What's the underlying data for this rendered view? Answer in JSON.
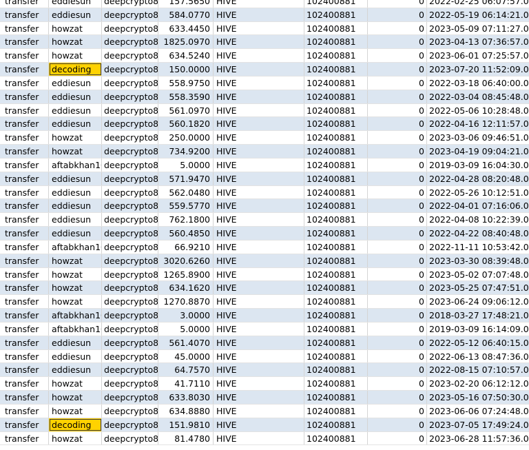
{
  "table": {
    "rows": [
      {
        "type": "transfer",
        "from": "eddiesun",
        "to": "deepcrypto8",
        "amount": "157.5650",
        "asset": "HIVE",
        "block": "102400881",
        "flag": "0",
        "date": "2022-02-25 06:07:57.000",
        "highlight": false
      },
      {
        "type": "transfer",
        "from": "eddiesun",
        "to": "deepcrypto8",
        "amount": "584.0770",
        "asset": "HIVE",
        "block": "102400881",
        "flag": "0",
        "date": "2022-05-19 06:14:21.000",
        "highlight": false
      },
      {
        "type": "transfer",
        "from": "howzat",
        "to": "deepcrypto8",
        "amount": "633.4450",
        "asset": "HIVE",
        "block": "102400881",
        "flag": "0",
        "date": "2023-05-09 07:11:27.000",
        "highlight": false
      },
      {
        "type": "transfer",
        "from": "howzat",
        "to": "deepcrypto8",
        "amount": "1825.0970",
        "asset": "HIVE",
        "block": "102400881",
        "flag": "0",
        "date": "2023-04-13 07:36:57.000",
        "highlight": false
      },
      {
        "type": "transfer",
        "from": "howzat",
        "to": "deepcrypto8",
        "amount": "634.5240",
        "asset": "HIVE",
        "block": "102400881",
        "flag": "0",
        "date": "2023-06-01 07:25:57.000",
        "highlight": false
      },
      {
        "type": "transfer",
        "from": "decoding",
        "to": "deepcrypto8",
        "amount": "150.0000",
        "asset": "HIVE",
        "block": "102400881",
        "flag": "0",
        "date": "2023-07-20 11:52:09.000",
        "highlight": true
      },
      {
        "type": "transfer",
        "from": "eddiesun",
        "to": "deepcrypto8",
        "amount": "558.9750",
        "asset": "HIVE",
        "block": "102400881",
        "flag": "0",
        "date": "2022-03-18 06:40:00.000",
        "highlight": false
      },
      {
        "type": "transfer",
        "from": "eddiesun",
        "to": "deepcrypto8",
        "amount": "558.3590",
        "asset": "HIVE",
        "block": "102400881",
        "flag": "0",
        "date": "2022-03-04 08:45:48.000",
        "highlight": false
      },
      {
        "type": "transfer",
        "from": "eddiesun",
        "to": "deepcrypto8",
        "amount": "561.0970",
        "asset": "HIVE",
        "block": "102400881",
        "flag": "0",
        "date": "2022-05-06 10:28:48.000",
        "highlight": false
      },
      {
        "type": "transfer",
        "from": "eddiesun",
        "to": "deepcrypto8",
        "amount": "560.1820",
        "asset": "HIVE",
        "block": "102400881",
        "flag": "0",
        "date": "2022-04-16 12:11:57.000",
        "highlight": false
      },
      {
        "type": "transfer",
        "from": "howzat",
        "to": "deepcrypto8",
        "amount": "250.0000",
        "asset": "HIVE",
        "block": "102400881",
        "flag": "0",
        "date": "2023-03-06 09:46:51.000",
        "highlight": false
      },
      {
        "type": "transfer",
        "from": "howzat",
        "to": "deepcrypto8",
        "amount": "734.9200",
        "asset": "HIVE",
        "block": "102400881",
        "flag": "0",
        "date": "2023-04-19 09:04:21.000",
        "highlight": false
      },
      {
        "type": "transfer",
        "from": "aftabkhan10",
        "to": "deepcrypto8",
        "amount": "5.0000",
        "asset": "HIVE",
        "block": "102400881",
        "flag": "0",
        "date": "2019-03-09 16:04:30.000",
        "highlight": false
      },
      {
        "type": "transfer",
        "from": "eddiesun",
        "to": "deepcrypto8",
        "amount": "571.9470",
        "asset": "HIVE",
        "block": "102400881",
        "flag": "0",
        "date": "2022-04-28 08:20:48.000",
        "highlight": false
      },
      {
        "type": "transfer",
        "from": "eddiesun",
        "to": "deepcrypto8",
        "amount": "562.0480",
        "asset": "HIVE",
        "block": "102400881",
        "flag": "0",
        "date": "2022-05-26 10:12:51.000",
        "highlight": false
      },
      {
        "type": "transfer",
        "from": "eddiesun",
        "to": "deepcrypto8",
        "amount": "559.5770",
        "asset": "HIVE",
        "block": "102400881",
        "flag": "0",
        "date": "2022-04-01 07:16:06.000",
        "highlight": false
      },
      {
        "type": "transfer",
        "from": "eddiesun",
        "to": "deepcrypto8",
        "amount": "762.1800",
        "asset": "HIVE",
        "block": "102400881",
        "flag": "0",
        "date": "2022-04-08 10:22:39.000",
        "highlight": false
      },
      {
        "type": "transfer",
        "from": "eddiesun",
        "to": "deepcrypto8",
        "amount": "560.4850",
        "asset": "HIVE",
        "block": "102400881",
        "flag": "0",
        "date": "2022-04-22 08:40:48.000",
        "highlight": false
      },
      {
        "type": "transfer",
        "from": "aftabkhan10",
        "to": "deepcrypto8",
        "amount": "66.9210",
        "asset": "HIVE",
        "block": "102400881",
        "flag": "0",
        "date": "2022-11-11 10:53:42.000",
        "highlight": false
      },
      {
        "type": "transfer",
        "from": "howzat",
        "to": "deepcrypto8",
        "amount": "3020.6260",
        "asset": "HIVE",
        "block": "102400881",
        "flag": "0",
        "date": "2023-03-30 08:39:48.000",
        "highlight": false
      },
      {
        "type": "transfer",
        "from": "howzat",
        "to": "deepcrypto8",
        "amount": "1265.8900",
        "asset": "HIVE",
        "block": "102400881",
        "flag": "0",
        "date": "2023-05-02 07:07:48.000",
        "highlight": false
      },
      {
        "type": "transfer",
        "from": "howzat",
        "to": "deepcrypto8",
        "amount": "634.1620",
        "asset": "HIVE",
        "block": "102400881",
        "flag": "0",
        "date": "2023-05-25 07:47:51.000",
        "highlight": false
      },
      {
        "type": "transfer",
        "from": "howzat",
        "to": "deepcrypto8",
        "amount": "1270.8870",
        "asset": "HIVE",
        "block": "102400881",
        "flag": "0",
        "date": "2023-06-24 09:06:12.000",
        "highlight": false
      },
      {
        "type": "transfer",
        "from": "aftabkhan10",
        "to": "deepcrypto8",
        "amount": "3.0000",
        "asset": "HIVE",
        "block": "102400881",
        "flag": "0",
        "date": "2018-03-27 17:48:21.000",
        "highlight": false
      },
      {
        "type": "transfer",
        "from": "aftabkhan10",
        "to": "deepcrypto8",
        "amount": "5.0000",
        "asset": "HIVE",
        "block": "102400881",
        "flag": "0",
        "date": "2019-03-09 16:14:09.000",
        "highlight": false
      },
      {
        "type": "transfer",
        "from": "eddiesun",
        "to": "deepcrypto8",
        "amount": "561.4070",
        "asset": "HIVE",
        "block": "102400881",
        "flag": "0",
        "date": "2022-05-12 06:40:15.000",
        "highlight": false
      },
      {
        "type": "transfer",
        "from": "eddiesun",
        "to": "deepcrypto8",
        "amount": "45.0000",
        "asset": "HIVE",
        "block": "102400881",
        "flag": "0",
        "date": "2022-06-13 08:47:36.000",
        "highlight": false
      },
      {
        "type": "transfer",
        "from": "eddiesun",
        "to": "deepcrypto8",
        "amount": "64.7570",
        "asset": "HIVE",
        "block": "102400881",
        "flag": "0",
        "date": "2022-08-15 07:10:57.000",
        "highlight": false
      },
      {
        "type": "transfer",
        "from": "howzat",
        "to": "deepcrypto8",
        "amount": "41.7110",
        "asset": "HIVE",
        "block": "102400881",
        "flag": "0",
        "date": "2023-02-20 06:12:12.000",
        "highlight": false
      },
      {
        "type": "transfer",
        "from": "howzat",
        "to": "deepcrypto8",
        "amount": "633.8030",
        "asset": "HIVE",
        "block": "102400881",
        "flag": "0",
        "date": "2023-05-16 07:50:30.000",
        "highlight": false
      },
      {
        "type": "transfer",
        "from": "howzat",
        "to": "deepcrypto8",
        "amount": "634.8880",
        "asset": "HIVE",
        "block": "102400881",
        "flag": "0",
        "date": "2023-06-06 07:24:48.000",
        "highlight": false
      },
      {
        "type": "transfer",
        "from": "decoding",
        "to": "deepcrypto8",
        "amount": "151.9810",
        "asset": "HIVE",
        "block": "102400881",
        "flag": "0",
        "date": "2023-07-05 17:49:24.000",
        "highlight": true
      },
      {
        "type": "transfer",
        "from": "howzat",
        "to": "deepcrypto8",
        "amount": "81.4780",
        "asset": "HIVE",
        "block": "102400881",
        "flag": "0",
        "date": "2023-06-28 11:57:36.000",
        "highlight": false
      }
    ]
  },
  "colors": {
    "row_alt": "#dce6f1",
    "row_plain": "#ffffff",
    "highlight": "#ffd200"
  }
}
